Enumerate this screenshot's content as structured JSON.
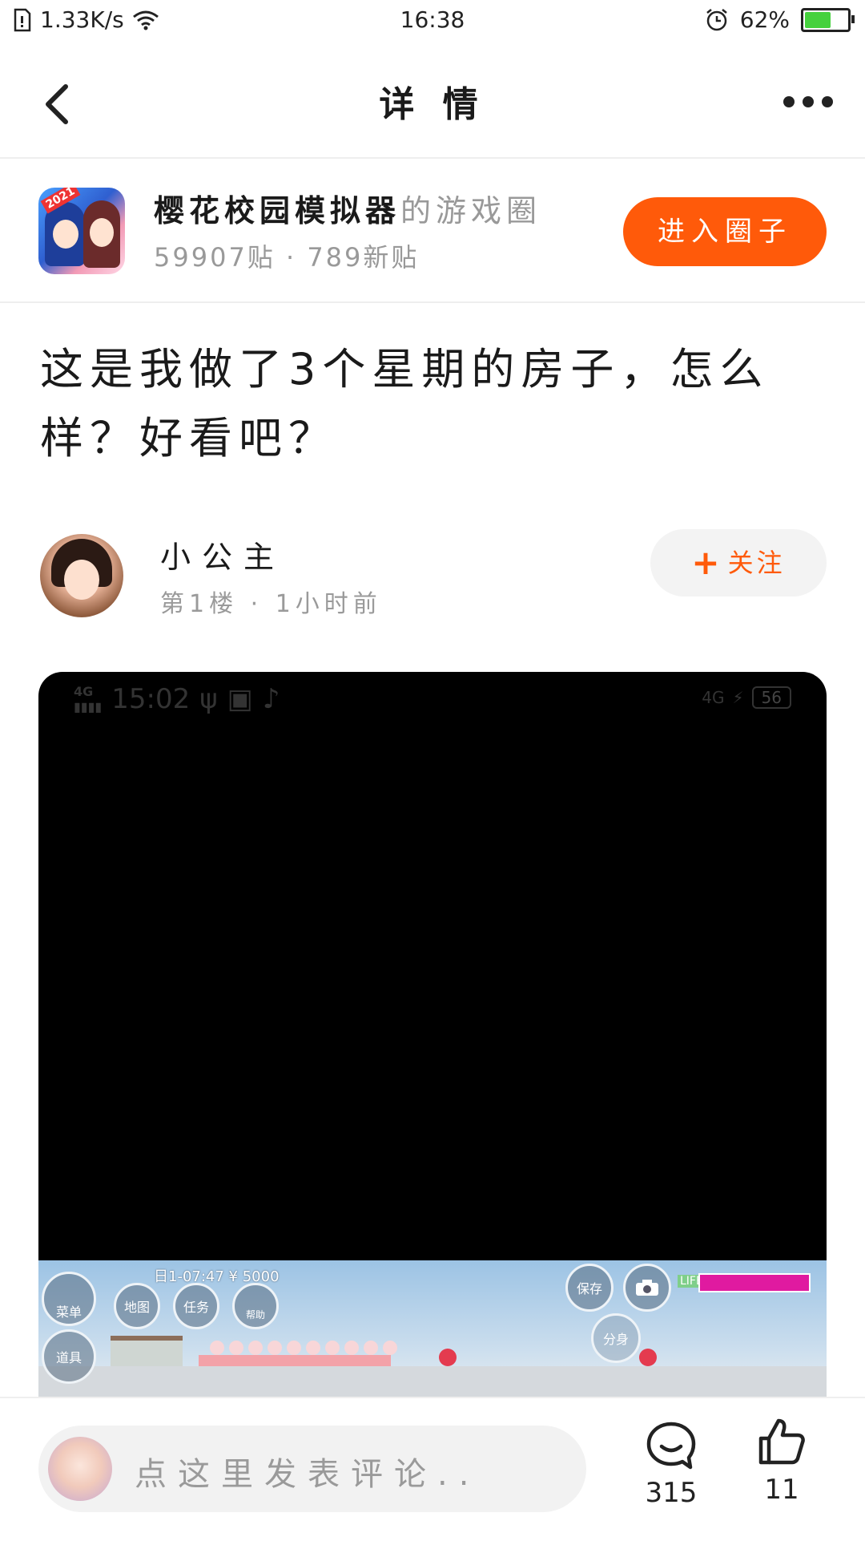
{
  "status_bar": {
    "network_speed": "1.33K/s",
    "time": "16:38",
    "battery_percent": "62%",
    "battery_level": 0.62,
    "icons": [
      "sim-icon",
      "wifi-icon",
      "alarm-icon",
      "battery-icon"
    ]
  },
  "nav": {
    "title": "详 情"
  },
  "circle": {
    "name": "樱花校园模拟器",
    "suffix": "的游戏圈",
    "stats": "59907贴 · 789新贴",
    "enter_label": "进入圈子",
    "logo_badge": "2021"
  },
  "post": {
    "title": "这是我做了3个星期的房子，怎么样？好看吧？"
  },
  "author": {
    "name": "小公主",
    "meta": "第1楼 · 1小时前",
    "follow_label": "关注"
  },
  "image": {
    "status_time": "15:02",
    "status_signal": "4G",
    "status_battery": "56",
    "game": {
      "info": "日1-07:47 ¥ 5000",
      "menu_label": "菜单",
      "props_label": "道具",
      "map_label": "地图",
      "task_label": "任务",
      "help_label": "帮助",
      "save_label": "保存",
      "split_label": "分身",
      "life_label": "LIFE"
    }
  },
  "bottom": {
    "comment_placeholder": "点这里发表评论..",
    "comment_count": "315",
    "like_count": "11"
  },
  "colors": {
    "accent": "#ff5a0a",
    "battery_fill": "#46d13e",
    "life_bar": "#e01aa0"
  }
}
